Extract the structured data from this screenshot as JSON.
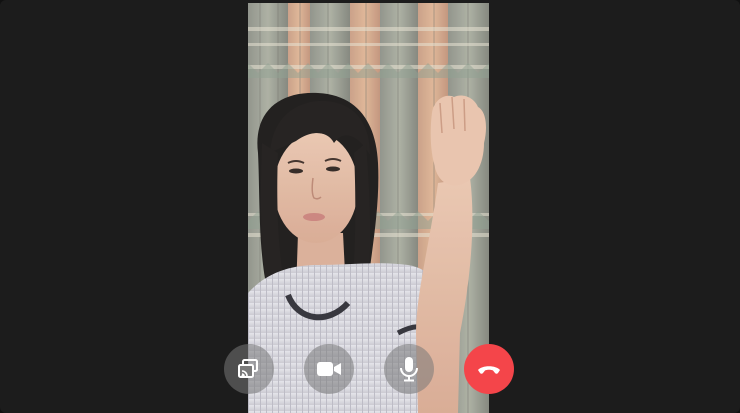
{
  "call": {
    "controls": [
      {
        "id": "cast",
        "icon": "cast-screen-icon"
      },
      {
        "id": "video",
        "icon": "video-camera-icon"
      },
      {
        "id": "mic",
        "icon": "microphone-icon"
      },
      {
        "id": "hangup",
        "icon": "end-call-icon",
        "color": "#f4454a"
      }
    ]
  },
  "colors": {
    "window_background": "#1c1c1c",
    "hangup": "#f4454a",
    "control_button": "#787878"
  }
}
